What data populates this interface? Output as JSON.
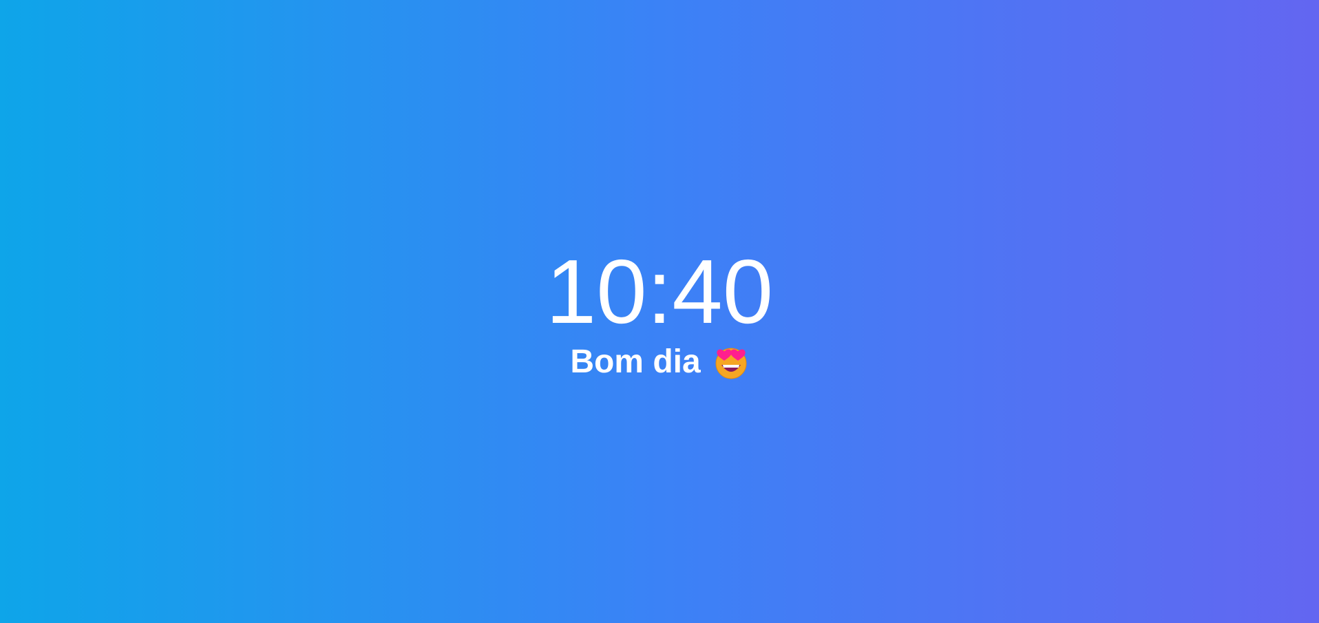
{
  "background": {
    "gradient_start": "#0ea5e9",
    "gradient_mid": "#3b82f6",
    "gradient_end": "#6366f1"
  },
  "clock": {
    "time": "10:40"
  },
  "greeting": {
    "text": "Bom dia",
    "emoji_icon": "star-struck-heart-eyes-face-icon"
  }
}
